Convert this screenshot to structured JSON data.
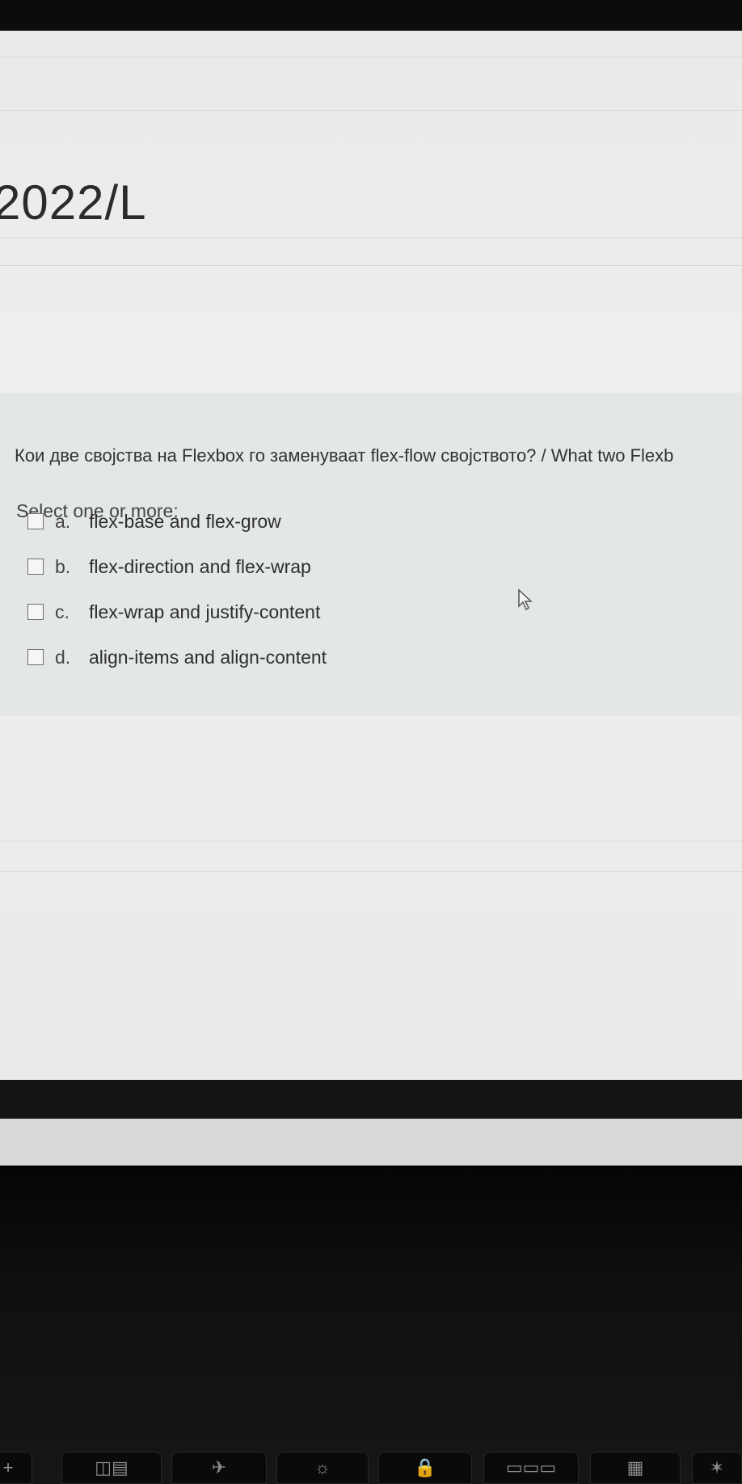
{
  "course": {
    "title_fragment": "2022/L"
  },
  "question": {
    "text": "Кои две својства на Flexbox го заменуваат flex-flow својството? / What two Flexb",
    "instruction": "Select one or more:",
    "options": [
      {
        "letter": "a.",
        "text": "flex-base and flex-grow",
        "checked": false
      },
      {
        "letter": "b.",
        "text": "flex-direction and flex-wrap",
        "checked": false
      },
      {
        "letter": "c.",
        "text": "flex-wrap and justify-content",
        "checked": false
      },
      {
        "letter": "d.",
        "text": "align-items and align-content",
        "checked": false
      }
    ]
  },
  "keyboard": {
    "keys": [
      {
        "icon": "plus-icon",
        "glyph": "+"
      },
      {
        "icon": "display-switch-icon",
        "glyph": "◫▤"
      },
      {
        "icon": "airplane-mode-icon",
        "glyph": "✈"
      },
      {
        "icon": "brightness-icon",
        "glyph": "☼"
      },
      {
        "icon": "lock-icon",
        "glyph": "🔒"
      },
      {
        "icon": "keyboard-backlight-icon",
        "glyph": "▭▭▭"
      },
      {
        "icon": "calculator-icon",
        "glyph": "▦"
      },
      {
        "icon": "star-icon",
        "glyph": "✶"
      }
    ]
  },
  "colors": {
    "page_background": "#efefef",
    "question_panel": "#e3e8e5",
    "text": "#333333",
    "bezel": "#111111"
  }
}
